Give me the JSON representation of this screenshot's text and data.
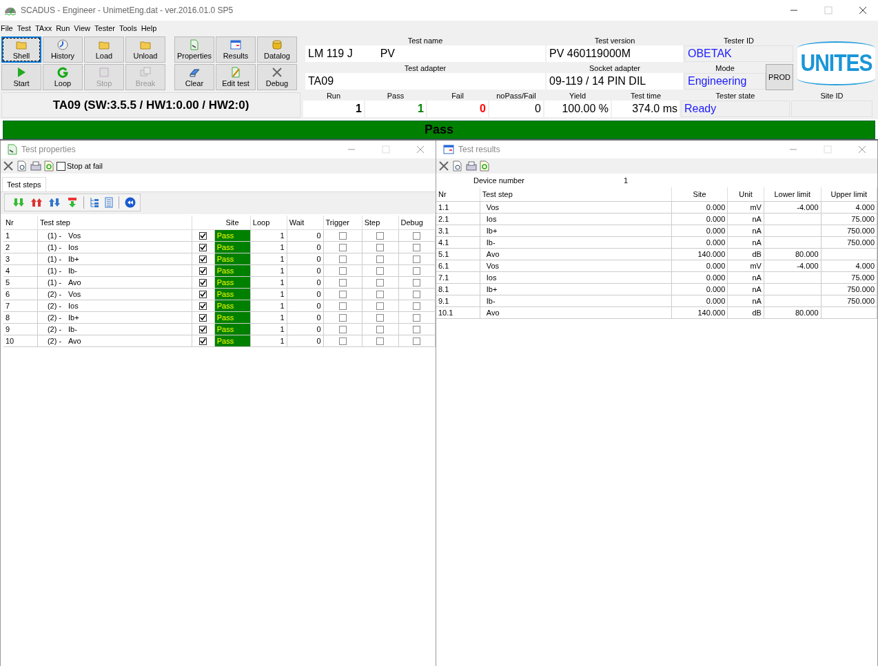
{
  "window": {
    "title": "SCADUS - Engineer - UnimetEng.dat - ver.2016.01.0 SP5"
  },
  "menu": [
    "File",
    "Test",
    "TAxx",
    "Run",
    "View",
    "Tester",
    "Tools",
    "Help"
  ],
  "toolbar": {
    "left": [
      {
        "label": "Shell",
        "disabled": false,
        "focused": true
      },
      {
        "label": "History",
        "disabled": false,
        "focused": false
      },
      {
        "label": "Load",
        "disabled": false,
        "focused": false
      },
      {
        "label": "Unload",
        "disabled": false,
        "focused": false
      },
      {
        "label": "Start",
        "disabled": false,
        "focused": false
      },
      {
        "label": "Loop",
        "disabled": false,
        "focused": false
      },
      {
        "label": "Stop",
        "disabled": true,
        "focused": false
      },
      {
        "label": "Break",
        "disabled": true,
        "focused": false
      }
    ],
    "right": [
      {
        "label": "Properties",
        "disabled": false,
        "focused": false
      },
      {
        "label": "Results",
        "disabled": false,
        "focused": false
      },
      {
        "label": "Datalog",
        "disabled": false,
        "focused": false
      },
      {
        "label": "Clear",
        "disabled": false,
        "focused": false
      },
      {
        "label": "Edit test",
        "disabled": false,
        "focused": false
      },
      {
        "label": "Debug",
        "disabled": false,
        "focused": false
      }
    ]
  },
  "info": {
    "test_name": {
      "label": "Test name",
      "value": "LM 119 J",
      "suffix": "PV"
    },
    "test_version": {
      "label": "Test version",
      "value": "PV 460119000M"
    },
    "tester_id": {
      "label": "Tester ID",
      "value": "OBETAK"
    },
    "test_adapter": {
      "label": "Test adapter",
      "value": "TA09"
    },
    "socket_adapter": {
      "label": "Socket adapter",
      "value": "09-119 / 14 PIN DIL"
    },
    "mode": {
      "label": "Mode",
      "value": "Engineering",
      "button": "PROD"
    },
    "logo": "UNITES"
  },
  "firmware": "TA09 (SW:3.5.5 / HW1:0.00 / HW2:0)",
  "counters": [
    {
      "label": "Run",
      "value": "1",
      "color": "#000000",
      "kind": "tally"
    },
    {
      "label": "Pass",
      "value": "1",
      "color": "#008000",
      "kind": "tally"
    },
    {
      "label": "Fail",
      "value": "0",
      "color": "#ff0000",
      "kind": "tally"
    },
    {
      "label": "noPass/Fail",
      "value": "0",
      "color": "#000000",
      "kind": "plain"
    },
    {
      "label": "Yield",
      "value": "100.00 %",
      "color": "#000000",
      "kind": "plain"
    },
    {
      "label": "Test time",
      "value": "374.0 ms",
      "color": "#000000",
      "kind": "plain"
    }
  ],
  "tester_state": {
    "label": "Tester state",
    "value": "Ready"
  },
  "site_id": {
    "label": "Site ID"
  },
  "result_banner": "Pass",
  "test_properties": {
    "title": "Test properties",
    "stop_at_fail": {
      "label": "Stop at fail",
      "checked": false
    },
    "tabs": [
      {
        "label": "Test steps",
        "selected": true
      }
    ],
    "columns": [
      "Nr",
      "Test step",
      "Site",
      "Loop",
      "Wait",
      "Trigger",
      "Step",
      "Debug"
    ],
    "rows": [
      {
        "nr": "1",
        "group": "(1) -",
        "name": "Vos",
        "enabled": true,
        "site": "Pass",
        "loop": "1",
        "wait": "0",
        "trigger": false,
        "step": false,
        "debug": false
      },
      {
        "nr": "2",
        "group": "(1) -",
        "name": "Ios",
        "enabled": true,
        "site": "Pass",
        "loop": "1",
        "wait": "0",
        "trigger": false,
        "step": false,
        "debug": false
      },
      {
        "nr": "3",
        "group": "(1) -",
        "name": "Ib+",
        "enabled": true,
        "site": "Pass",
        "loop": "1",
        "wait": "0",
        "trigger": false,
        "step": false,
        "debug": false
      },
      {
        "nr": "4",
        "group": "(1) -",
        "name": "Ib-",
        "enabled": true,
        "site": "Pass",
        "loop": "1",
        "wait": "0",
        "trigger": false,
        "step": false,
        "debug": false
      },
      {
        "nr": "5",
        "group": "(1) -",
        "name": "Avo",
        "enabled": true,
        "site": "Pass",
        "loop": "1",
        "wait": "0",
        "trigger": false,
        "step": false,
        "debug": false
      },
      {
        "nr": "6",
        "group": "(2) -",
        "name": "Vos",
        "enabled": true,
        "site": "Pass",
        "loop": "1",
        "wait": "0",
        "trigger": false,
        "step": false,
        "debug": false
      },
      {
        "nr": "7",
        "group": "(2) -",
        "name": "Ios",
        "enabled": true,
        "site": "Pass",
        "loop": "1",
        "wait": "0",
        "trigger": false,
        "step": false,
        "debug": false
      },
      {
        "nr": "8",
        "group": "(2) -",
        "name": "Ib+",
        "enabled": true,
        "site": "Pass",
        "loop": "1",
        "wait": "0",
        "trigger": false,
        "step": false,
        "debug": false
      },
      {
        "nr": "9",
        "group": "(2) -",
        "name": "Ib-",
        "enabled": true,
        "site": "Pass",
        "loop": "1",
        "wait": "0",
        "trigger": false,
        "step": false,
        "debug": false
      },
      {
        "nr": "10",
        "group": "(2) -",
        "name": "Avo",
        "enabled": true,
        "site": "Pass",
        "loop": "1",
        "wait": "0",
        "trigger": false,
        "step": false,
        "debug": false
      }
    ]
  },
  "test_results": {
    "title": "Test results",
    "device_number": {
      "label": "Device number",
      "value": "1"
    },
    "columns": [
      "Nr",
      "Test step",
      "Site",
      "Unit",
      "Lower limit",
      "Upper limit"
    ],
    "rows": [
      [
        "1.1",
        "Vos",
        "0.000",
        "mV",
        "-4.000",
        "4.000"
      ],
      [
        "2.1",
        "Ios",
        "0.000",
        "nA",
        "",
        "75.000"
      ],
      [
        "3.1",
        "Ib+",
        "0.000",
        "nA",
        "",
        "750.000"
      ],
      [
        "4.1",
        "Ib-",
        "0.000",
        "nA",
        "",
        "750.000"
      ],
      [
        "5.1",
        "Avo",
        "140.000",
        "dB",
        "80.000",
        ""
      ],
      [
        "6.1",
        "Vos",
        "0.000",
        "mV",
        "-4.000",
        "4.000"
      ],
      [
        "7.1",
        "Ios",
        "0.000",
        "nA",
        "",
        "75.000"
      ],
      [
        "8.1",
        "Ib+",
        "0.000",
        "nA",
        "",
        "750.000"
      ],
      [
        "9.1",
        "Ib-",
        "0.000",
        "nA",
        "",
        "750.000"
      ],
      [
        "10.1",
        "Avo",
        "140.000",
        "dB",
        "80.000",
        ""
      ]
    ]
  }
}
